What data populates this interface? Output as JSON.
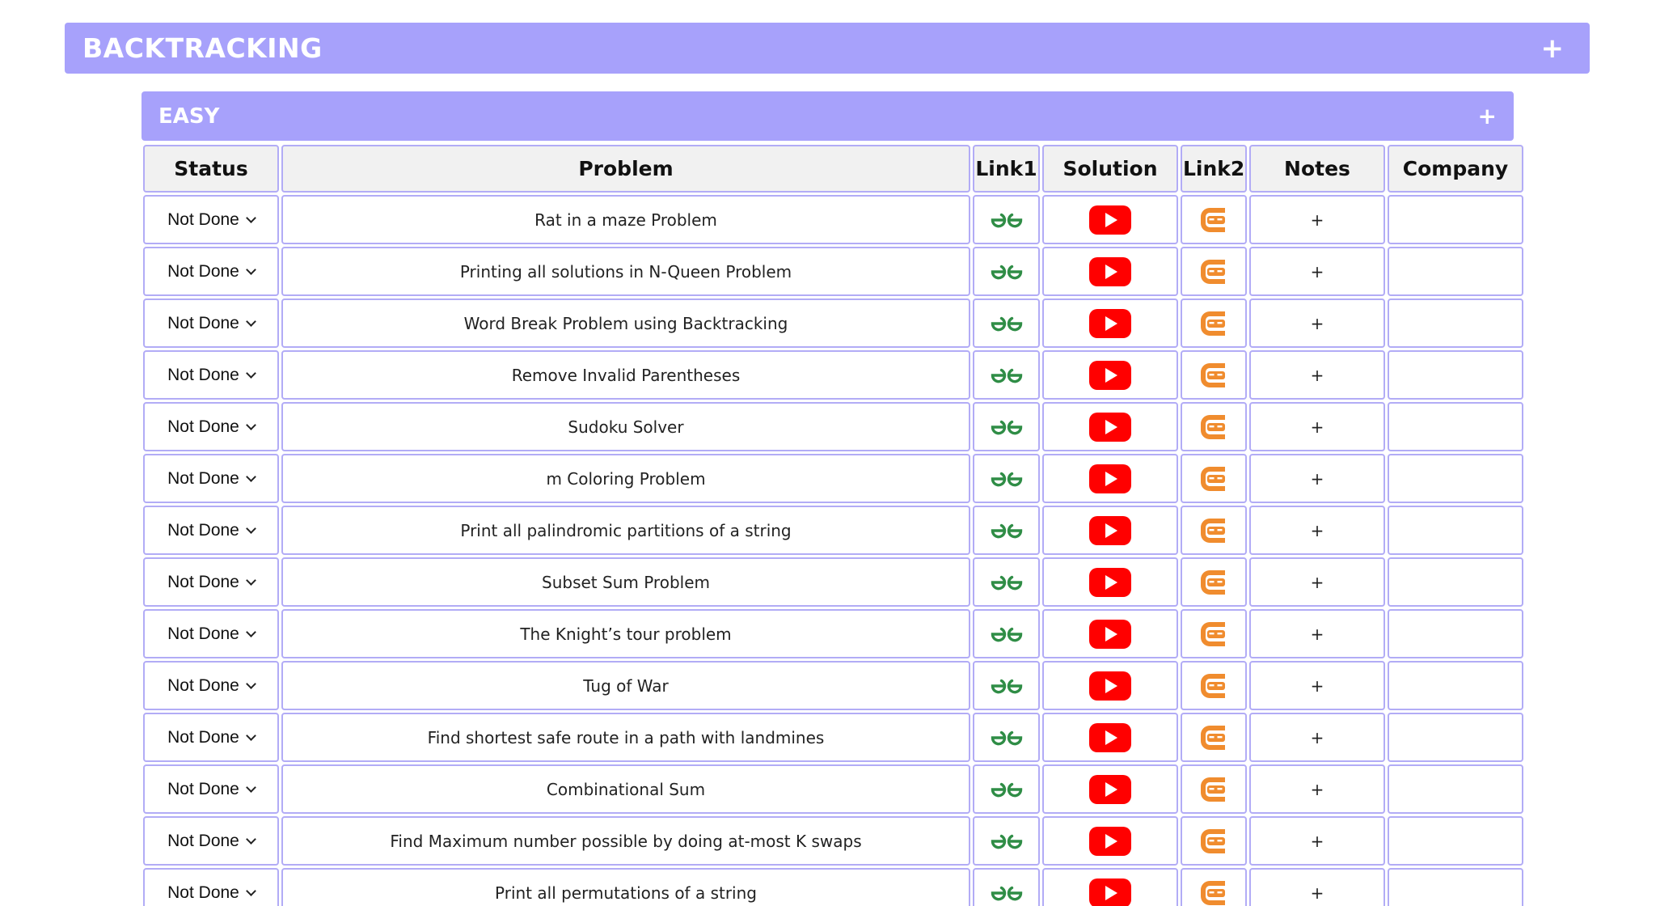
{
  "topic": {
    "title": "BACKTRACKING",
    "toggle": "+"
  },
  "section": {
    "title": "EASY",
    "toggle": "+"
  },
  "table": {
    "headers": [
      "Status",
      "Problem",
      "Link1",
      "Solution",
      "Link2",
      "Notes",
      "Company"
    ],
    "notes_label": "+",
    "icons": {
      "link1": "gfg-icon",
      "solution": "youtube-play-icon",
      "link2": "codingninjas-icon"
    },
    "colors": {
      "accent": "#a7a1fb",
      "cell_border": "#b2acf6",
      "gfg_green": "#2f8d46",
      "youtube_red": "#ff0000",
      "cn_orange": "#f08c2e"
    },
    "rows": [
      {
        "status": "Not Done",
        "problem": "Rat in a maze Problem",
        "company": ""
      },
      {
        "status": "Not Done",
        "problem": "Printing all solutions in N-Queen Problem",
        "company": ""
      },
      {
        "status": "Not Done",
        "problem": "Word Break Problem using Backtracking",
        "company": ""
      },
      {
        "status": "Not Done",
        "problem": "Remove Invalid Parentheses",
        "company": ""
      },
      {
        "status": "Not Done",
        "problem": "Sudoku Solver",
        "company": ""
      },
      {
        "status": "Not Done",
        "problem": "m Coloring Problem",
        "company": ""
      },
      {
        "status": "Not Done",
        "problem": "Print all palindromic partitions of a string",
        "company": ""
      },
      {
        "status": "Not Done",
        "problem": "Subset Sum Problem",
        "company": ""
      },
      {
        "status": "Not Done",
        "problem": "The Knight’s tour problem",
        "company": ""
      },
      {
        "status": "Not Done",
        "problem": "Tug of War",
        "company": ""
      },
      {
        "status": "Not Done",
        "problem": "Find shortest safe route in a path with landmines",
        "company": ""
      },
      {
        "status": "Not Done",
        "problem": "Combinational Sum",
        "company": ""
      },
      {
        "status": "Not Done",
        "problem": "Find Maximum number possible by doing at-most K swaps",
        "company": ""
      },
      {
        "status": "Not Done",
        "problem": "Print all permutations of a string",
        "company": ""
      }
    ]
  }
}
